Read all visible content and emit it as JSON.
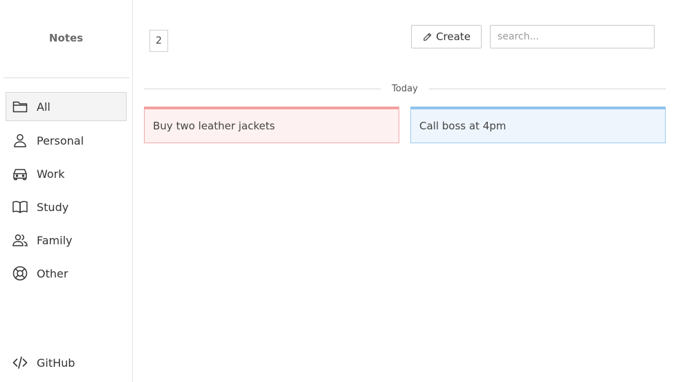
{
  "sidebar": {
    "brand": "Notes",
    "items": [
      {
        "label": "All",
        "icon": "folder-icon",
        "active": true
      },
      {
        "label": "Personal",
        "icon": "user-icon"
      },
      {
        "label": "Work",
        "icon": "car-icon"
      },
      {
        "label": "Study",
        "icon": "book-icon"
      },
      {
        "label": "Family",
        "icon": "users-icon"
      },
      {
        "label": "Other",
        "icon": "lifebuoy-icon"
      }
    ],
    "footer": {
      "label": "GitHub",
      "icon": "code-icon"
    }
  },
  "toolbar": {
    "count": "2",
    "create_label": "Create",
    "search_placeholder": "search..."
  },
  "group": {
    "label": "Today"
  },
  "notes": [
    {
      "text": "Buy two leather jackets",
      "color": "#f3a0a0"
    },
    {
      "text": "Call boss at 4pm",
      "color": "#90c2ee"
    }
  ]
}
